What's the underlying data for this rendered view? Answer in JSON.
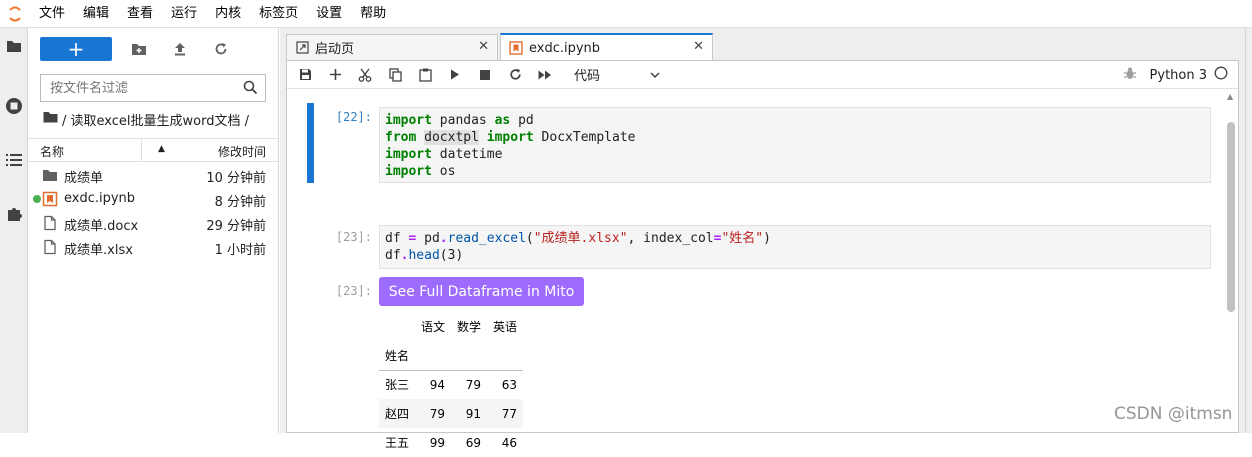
{
  "menu": [
    "文件",
    "编辑",
    "查看",
    "运行",
    "内核",
    "标签页",
    "设置",
    "帮助"
  ],
  "filebrowser": {
    "new_label": "+",
    "search_placeholder": "按文件名过滤",
    "breadcrumb": "/ 读取excel批量生成word文档 /",
    "col_name": "名称",
    "col_modified": "修改时间",
    "files": [
      {
        "name": "成绩单",
        "time": "10 分钟前",
        "icon": "folder-icon"
      },
      {
        "name": "exdc.ipynb",
        "time": "8 分钟前",
        "icon": "notebook-icon"
      },
      {
        "name": "成绩单.docx",
        "time": "29 分钟前",
        "icon": "file-icon"
      },
      {
        "name": "成绩单.xlsx",
        "time": "1 小时前",
        "icon": "file-icon"
      }
    ]
  },
  "tabs": [
    {
      "label": "启动页",
      "active": false
    },
    {
      "label": "exdc.ipynb",
      "active": true
    }
  ],
  "toolbar": {
    "cell_type": "代码",
    "kernel_name": "Python 3"
  },
  "cells": {
    "c1_prompt": "[22]:",
    "c2_prompt": "[23]:",
    "out_prompt": "[23]:"
  },
  "mito_button": "See Full Dataframe in Mito",
  "dataframe": {
    "columns": [
      "语文",
      "数学",
      "英语"
    ],
    "index_name": "姓名",
    "rows": [
      {
        "name": "张三",
        "v": [
          "94",
          "79",
          "63"
        ]
      },
      {
        "name": "赵四",
        "v": [
          "79",
          "91",
          "77"
        ]
      },
      {
        "name": "王五",
        "v": [
          "99",
          "69",
          "46"
        ]
      }
    ]
  },
  "watermark": "CSDN @itmsn",
  "colors": {
    "accent": "#1976d2",
    "mito": "#9d6cff",
    "running": "#4caf50"
  }
}
